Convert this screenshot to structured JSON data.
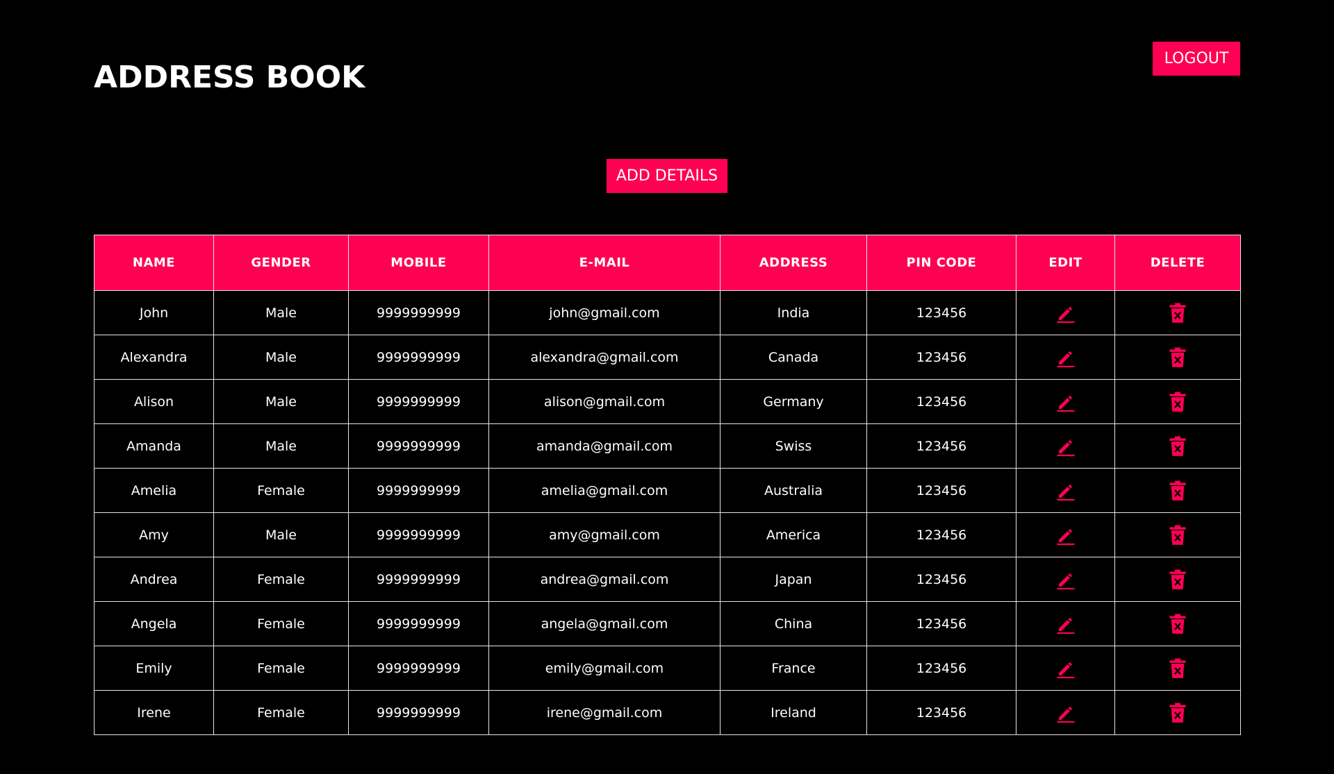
{
  "header": {
    "title": "ADDRESS BOOK",
    "logout_label": "LOGOUT"
  },
  "actions": {
    "add_label": "ADD DETAILS"
  },
  "colors": {
    "accent": "#ff0055",
    "background": "#000000",
    "text": "#ffffff",
    "border": "#e6e6e6"
  },
  "table": {
    "columns": [
      "NAME",
      "GENDER",
      "MOBILE",
      "E-MAIL",
      "ADDRESS",
      "PIN CODE",
      "EDIT",
      "DELETE"
    ],
    "edit_icon": "pencil-icon",
    "delete_icon": "trash-icon",
    "rows": [
      {
        "name": "John",
        "gender": "Male",
        "mobile": "9999999999",
        "email": "john@gmail.com",
        "address": "India",
        "pin": "123456"
      },
      {
        "name": "Alexandra",
        "gender": "Male",
        "mobile": "9999999999",
        "email": "alexandra@gmail.com",
        "address": "Canada",
        "pin": "123456"
      },
      {
        "name": "Alison",
        "gender": "Male",
        "mobile": "9999999999",
        "email": "alison@gmail.com",
        "address": "Germany",
        "pin": "123456"
      },
      {
        "name": "Amanda",
        "gender": "Male",
        "mobile": "9999999999",
        "email": "amanda@gmail.com",
        "address": "Swiss",
        "pin": "123456"
      },
      {
        "name": "Amelia",
        "gender": "Female",
        "mobile": "9999999999",
        "email": "amelia@gmail.com",
        "address": "Australia",
        "pin": "123456"
      },
      {
        "name": "Amy",
        "gender": "Male",
        "mobile": "9999999999",
        "email": "amy@gmail.com",
        "address": "America",
        "pin": "123456"
      },
      {
        "name": "Andrea",
        "gender": "Female",
        "mobile": "9999999999",
        "email": "andrea@gmail.com",
        "address": "Japan",
        "pin": "123456"
      },
      {
        "name": "Angela",
        "gender": "Female",
        "mobile": "9999999999",
        "email": "angela@gmail.com",
        "address": "China",
        "pin": "123456"
      },
      {
        "name": "Emily",
        "gender": "Female",
        "mobile": "9999999999",
        "email": "emily@gmail.com",
        "address": "France",
        "pin": "123456"
      },
      {
        "name": "Irene",
        "gender": "Female",
        "mobile": "9999999999",
        "email": "irene@gmail.com",
        "address": "Ireland",
        "pin": "123456"
      }
    ]
  }
}
